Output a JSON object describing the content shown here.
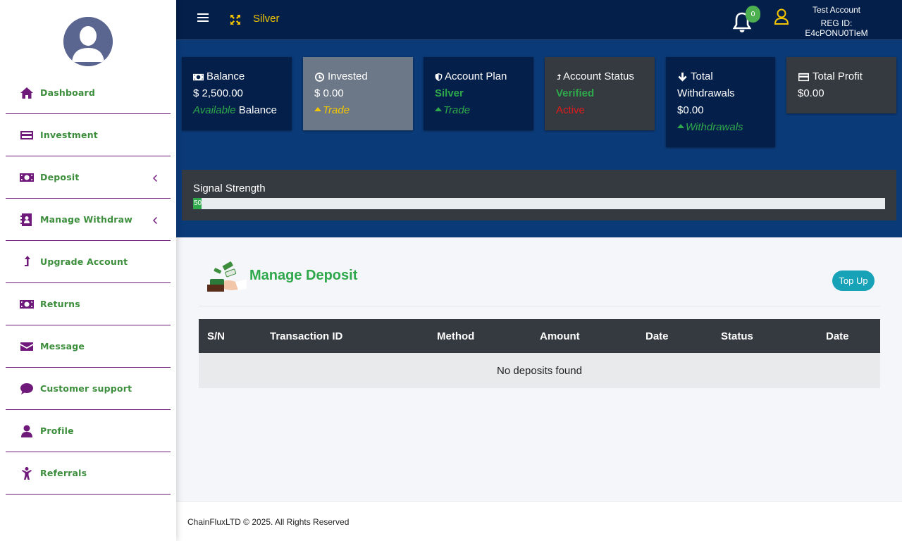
{
  "sidebar": {
    "items": [
      {
        "label": "Dashboard",
        "icon": "home-icon"
      },
      {
        "label": "Investment",
        "icon": "credit-card-icon"
      },
      {
        "label": "Deposit",
        "icon": "money-icon",
        "has_submenu": true
      },
      {
        "label": "Manage Withdraw",
        "icon": "address-book-icon",
        "has_submenu": true
      },
      {
        "label": "Upgrade Account",
        "icon": "upgrade-arrow-icon"
      },
      {
        "label": "Returns",
        "icon": "money-icon"
      },
      {
        "label": "Message",
        "icon": "envelope-icon"
      },
      {
        "label": "Customer support",
        "icon": "chat-bubble-icon"
      },
      {
        "label": "Profile",
        "icon": "user-icon"
      },
      {
        "label": "Referrals",
        "icon": "child-icon"
      }
    ]
  },
  "topbar": {
    "plan": "Silver",
    "notification_count": "0",
    "user_name": "Test Account",
    "reg_id": "REG ID: E4cPONU0TIeM"
  },
  "cards": {
    "balance": {
      "title": "Balance",
      "value": "$ 2,500.00",
      "sub_italic": "Available",
      "sub_rest": " Balance"
    },
    "invested": {
      "title": "Invested",
      "value": "$ 0.00",
      "sub": "Trade"
    },
    "plan": {
      "title": "Account Plan",
      "value": "Silver",
      "sub": "Trade"
    },
    "status": {
      "title": "Account Status",
      "value": "Verified",
      "sub": "Active"
    },
    "withdrawals": {
      "title_line1": "Total",
      "title_line2": "Withdrawals",
      "value": "$0.00",
      "sub": "Withdrawals"
    },
    "profit": {
      "title": "Total Profit",
      "value": "$0.00"
    }
  },
  "signal": {
    "label": "Signal Strength",
    "value": "50",
    "fraction": 0.012
  },
  "deposit": {
    "title": "Manage Deposit",
    "top_up_label": "Top Up",
    "columns": [
      "S/N",
      "Transaction ID",
      "Method",
      "Amount",
      "Date",
      "Status",
      "Date"
    ],
    "empty_message": "No deposits found"
  },
  "footer": {
    "text": "ChainFluxLTD © 2025. All Rights Reserved"
  },
  "colors": {
    "navy": "#041f4a",
    "band": "#0b3a78",
    "green": "#2ea84a",
    "purple": "#6f1a7a",
    "gold": "#f2c500",
    "teal": "#17a2b8"
  }
}
